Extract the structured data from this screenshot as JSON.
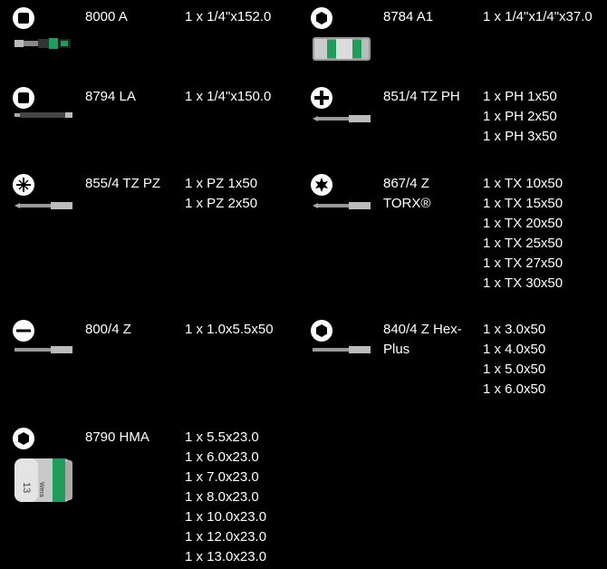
{
  "items": [
    {
      "code": "8000 A",
      "icon": "square-drive-icon",
      "lines": [
        "1 x 1/4\"x152.0"
      ]
    },
    {
      "code": "8784 A1",
      "icon": "hex-socket-icon",
      "lines": [
        "1 x 1/4\"x1/4\"x37.0"
      ]
    },
    {
      "code": "8794 LA",
      "icon": "square-drive-icon",
      "lines": [
        "1 x 1/4\"x150.0"
      ]
    },
    {
      "code": "851/4 TZ PH",
      "icon": "phillips-icon",
      "lines": [
        "1 x PH 1x50",
        "1 x PH 2x50",
        "1 x PH 3x50"
      ]
    },
    {
      "code": "855/4 TZ PZ",
      "icon": "pozidriv-icon",
      "lines": [
        "1 x PZ 1x50",
        "1 x PZ 2x50"
      ]
    },
    {
      "code_lines": [
        "867/4 Z",
        "TORX®"
      ],
      "icon": "torx-icon",
      "lines": [
        "1 x TX 10x50",
        "1 x TX 15x50",
        "1 x TX 20x50",
        "1 x TX 25x50",
        "1 x TX 27x50",
        "1 x TX 30x50"
      ]
    },
    {
      "code": "800/4 Z",
      "icon": "slotted-icon",
      "lines": [
        "1 x 1.0x5.5x50"
      ]
    },
    {
      "code_lines": [
        "840/4 Z Hex-",
        "Plus"
      ],
      "icon": "hex-plus-icon",
      "lines": [
        "1 x 3.0x50",
        "1 x 4.0x50",
        "1 x 5.0x50",
        "1 x 6.0x50"
      ]
    },
    {
      "code": "8790 HMA",
      "icon": "hex-socket-icon",
      "lines": [
        "1 x 5.5x23.0",
        "1 x 6.0x23.0",
        "1 x 7.0x23.0",
        "1 x 8.0x23.0",
        "1 x 10.0x23.0",
        "1 x 12.0x23.0",
        "1 x 13.0x23.0"
      ]
    }
  ],
  "socket_label": "13",
  "brand_mark": "Wera",
  "colors": {
    "background": "#000000",
    "text": "#ffffff",
    "accent_green": "#1e9e5a"
  }
}
